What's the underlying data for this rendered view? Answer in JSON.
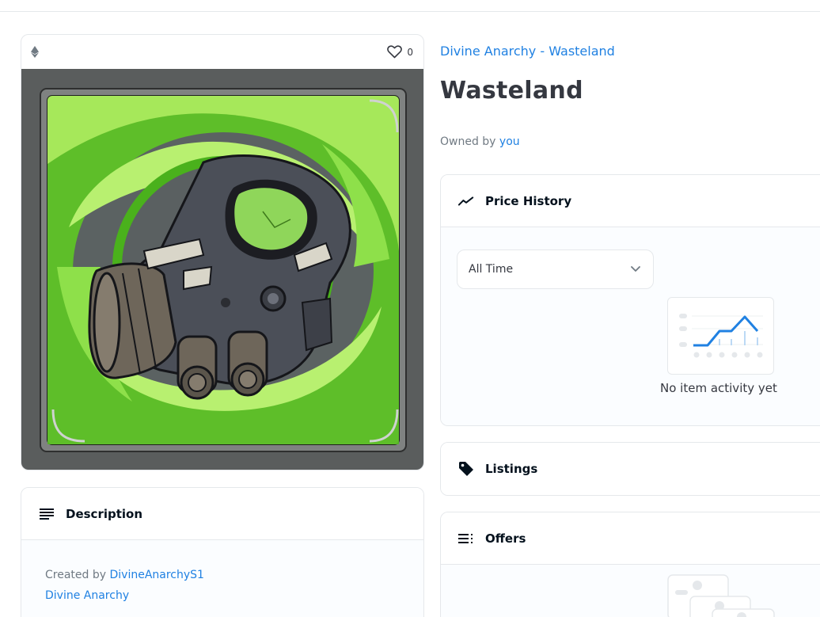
{
  "media": {
    "favorites_count": "0",
    "chain_icon": "ethereum-icon",
    "favorite_icon": "heart-icon"
  },
  "description": {
    "title": "Description",
    "created_by_label": "Created by",
    "creator": "DivineAnarchyS1",
    "collection": "Divine Anarchy"
  },
  "item": {
    "collection_link": "Divine Anarchy - Wasteland",
    "title": "Wasteland",
    "owned_by_label": "Owned by",
    "owner": "you"
  },
  "price_history": {
    "title": "Price History",
    "range_selected": "All Time",
    "empty_message": "No item activity yet"
  },
  "listings": {
    "title": "Listings"
  },
  "offers": {
    "title": "Offers"
  },
  "colors": {
    "accent": "#2081e2",
    "border": "#e5e8eb",
    "art_green": "#a6e85a"
  }
}
